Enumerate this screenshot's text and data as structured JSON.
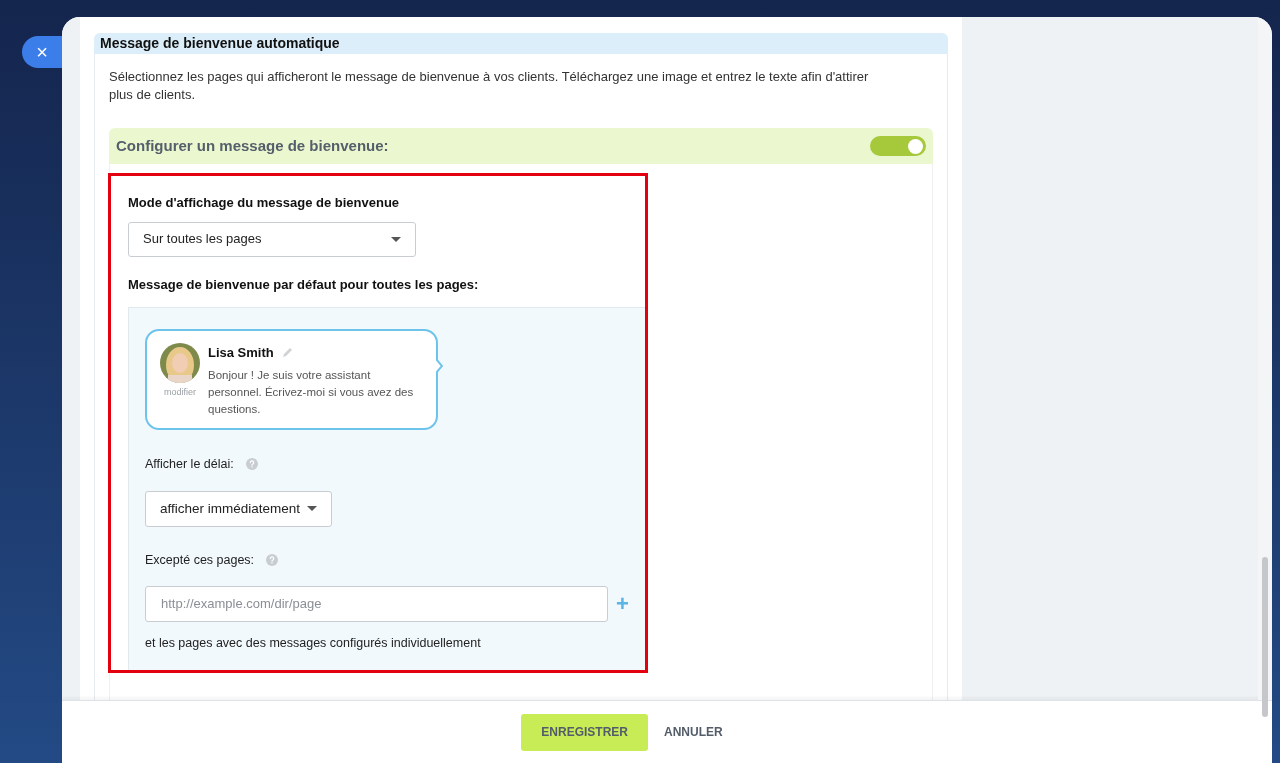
{
  "close_button": {
    "label": "×"
  },
  "section": {
    "title": "Message de bienvenue automatique",
    "description": "Sélectionnez les pages qui afficheront le message de bienvenue à vos clients. Téléchargez une image et entrez le texte afin d'attirer plus de clients."
  },
  "config": {
    "label": "Configurer un message de bienvenue:",
    "on": true
  },
  "mode": {
    "label": "Mode d'affichage du message de bienvenue",
    "value": "Sur toutes les pages"
  },
  "default_message": {
    "label": "Message de bienvenue par défaut pour toutes les pages:",
    "chat": {
      "name": "Lisa Smith",
      "text": "Bonjour ! Je suis votre assistant personnel. Écrivez-moi si vous avez des questions.",
      "avatar_caption": "modifier"
    }
  },
  "delay": {
    "label": "Afficher le délai:",
    "value": "afficher immédiatement"
  },
  "exceptions": {
    "label": "Excepté ces pages:",
    "placeholder": "http://example.com/dir/page",
    "add": "+",
    "note": "et les pages avec des messages configurés individuellement"
  },
  "buttons": [
    {
      "label": "ENREGISTRER",
      "kind": "primary"
    },
    {
      "label": "ANNULER",
      "kind": "link"
    }
  ]
}
